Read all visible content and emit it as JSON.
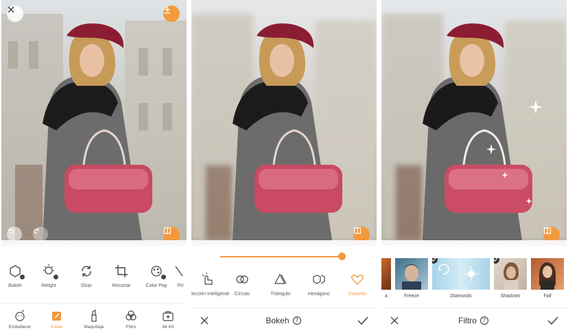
{
  "colors": {
    "accent": "#f39a3d",
    "text": "#555555"
  },
  "panel1": {
    "tools": [
      {
        "label": "Bokeh",
        "icon": "bokeh-icon"
      },
      {
        "label": "Relight",
        "icon": "relight-icon"
      },
      {
        "label": "Girar",
        "icon": "rotate-icon"
      },
      {
        "label": "Recortar",
        "icon": "crop-icon"
      },
      {
        "label": "Color Pop",
        "icon": "color-pop-icon"
      },
      {
        "label": "Pri",
        "icon": "partial-icon"
      }
    ],
    "nav": [
      {
        "label": "Embellecer",
        "icon": "face-retouch-icon"
      },
      {
        "label": "Editar",
        "icon": "edit-icon"
      },
      {
        "label": "Maquillaje",
        "icon": "makeup-icon"
      },
      {
        "label": "Filtro",
        "icon": "filter-icon"
      },
      {
        "label": "Mi Kit",
        "icon": "kit-icon"
      }
    ]
  },
  "panel2": {
    "slider_value": 1.0,
    "shapes": [
      {
        "label": "Selección Inteligente",
        "icon": "smart-selection-icon"
      },
      {
        "label": "Círculo",
        "icon": "circle-shape-icon"
      },
      {
        "label": "Triángulo",
        "icon": "triangle-shape-icon"
      },
      {
        "label": "Hexágono",
        "icon": "hexagon-shape-icon"
      },
      {
        "label": "Corazón",
        "icon": "heart-shape-icon"
      }
    ],
    "title": "Bokeh",
    "help": "?"
  },
  "panel3": {
    "filters": [
      {
        "label": "a"
      },
      {
        "label": "Freeze"
      },
      {
        "label": "Diamonds"
      },
      {
        "label": "Shadows"
      },
      {
        "label": "Fall"
      }
    ],
    "title": "Filtro",
    "help": "?"
  }
}
